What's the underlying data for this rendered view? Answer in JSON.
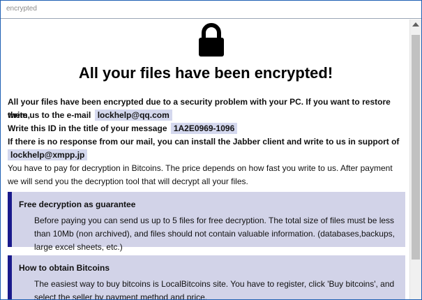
{
  "window": {
    "title": "encrypted"
  },
  "icons": {
    "lock": "lock-icon"
  },
  "colors": {
    "accent": "#1a1a8c",
    "box_bg": "#d2d3e8",
    "code_bg": "#d4d8ee"
  },
  "main": {
    "headline": "All your files have been encrypted!",
    "line1": "All your files have been encrypted due to a security problem with your PC. If you want to restore them,",
    "line2_prefix": "write us to the e-mail",
    "email": "lockhelp@qq.com",
    "line3_prefix": "Write this ID in the title of your message",
    "id": "1A2E0969-1096",
    "line4": "If there is no response from our mail, you can install the Jabber client and write to us in support of",
    "jabber": "lockhelp@xmpp.jp",
    "pay_text": "You have to pay for decryption in Bitcoins. The price depends on how fast you write to us. After payment we will send you the decryption tool that will decrypt all your files."
  },
  "boxes": [
    {
      "title": "Free decryption as guarantee",
      "body": "Before paying you can send us up to 5 files for free decryption. The total size of files must be less than 10Mb (non archived), and files should not contain valuable information. (databases,backups, large excel sheets, etc.)"
    },
    {
      "title": "How to obtain Bitcoins",
      "body": "The easiest way to buy bitcoins is LocalBitcoins site. You have to register, click 'Buy bitcoins', and select the seller by payment method and price."
    }
  ]
}
